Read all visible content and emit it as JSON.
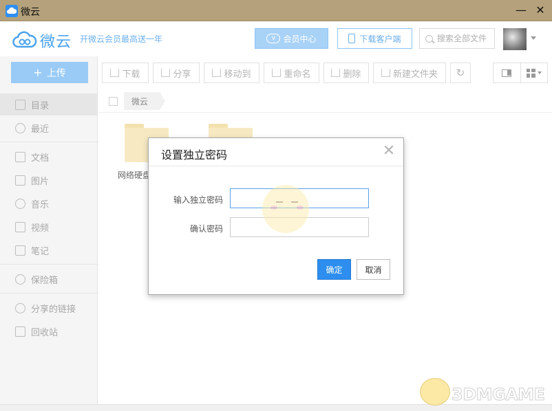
{
  "window": {
    "title": "微云"
  },
  "header": {
    "logo_text": "微云",
    "promo": "开微云会员最高送一年",
    "vip_label": "会员中心",
    "download_label": "下载客户端",
    "search_placeholder": "搜索全部文件"
  },
  "sidebar": {
    "upload_label": "上传",
    "items": [
      {
        "label": "目录",
        "icon": "list-icon"
      },
      {
        "label": "最近",
        "icon": "clock-icon"
      },
      {
        "label": "文档",
        "icon": "document-icon"
      },
      {
        "label": "图片",
        "icon": "image-icon"
      },
      {
        "label": "音乐",
        "icon": "music-icon"
      },
      {
        "label": "视频",
        "icon": "video-icon"
      },
      {
        "label": "笔记",
        "icon": "note-icon"
      },
      {
        "label": "保险箱",
        "icon": "shield-icon"
      },
      {
        "label": "分享的链接",
        "icon": "share-icon"
      },
      {
        "label": "回收站",
        "icon": "trash-icon"
      }
    ]
  },
  "toolbar": {
    "download": "下载",
    "share": "分享",
    "move_to": "移动到",
    "rename": "重命名",
    "delete": "删除",
    "new_folder": "新建文件夹"
  },
  "breadcrumb": {
    "current": "微云"
  },
  "files": [
    {
      "name": "网络硬盘"
    },
    {
      "name": ""
    }
  ],
  "dialog": {
    "title": "设置独立密码",
    "password_label": "输入独立密码",
    "confirm_label": "确认密码",
    "password_value": "",
    "confirm_value": "",
    "ok_label": "确定",
    "cancel_label": "取消"
  },
  "watermark": {
    "text": "3DMGAME"
  },
  "colors": {
    "accent": "#2d8ef0",
    "titlebar": "#b5a27c"
  }
}
